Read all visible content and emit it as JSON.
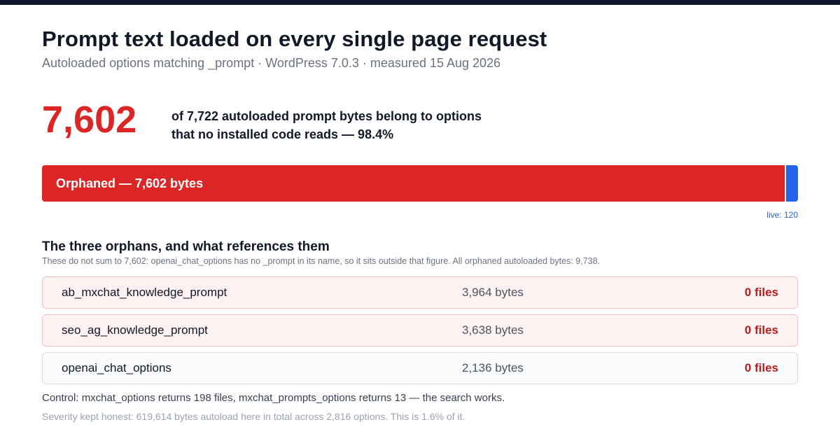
{
  "header": {
    "title": "Prompt text loaded on every single page request",
    "subtitle": "Autoloaded options matching _prompt · WordPress 7.0.3 · measured 15 Aug 2026"
  },
  "headline": {
    "value": "7,602",
    "description_line1": "of 7,722 autoloaded prompt bytes belong to options",
    "description_line2": "that no installed code reads — 98.4%"
  },
  "bar": {
    "orphaned_bytes": 7602,
    "live_bytes": 120,
    "orphaned_label": "Orphaned — 7,602 bytes",
    "live_label": "live: 120",
    "colors": {
      "orphaned": "#dc2626",
      "live": "#2563eb"
    }
  },
  "orphans": {
    "title": "The three orphans, and what references them",
    "note": "These do not sum to 7,602: openai_chat_options has no _prompt in its name, so it sits outside that figure. All orphaned autoloaded bytes: 9,738.",
    "rows": [
      {
        "name": "ab_mxchat_knowledge_prompt",
        "bytes": "3,964 bytes",
        "files": "0 files",
        "style": "orphan"
      },
      {
        "name": "seo_ag_knowledge_prompt",
        "bytes": "3,638 bytes",
        "files": "0 files",
        "style": "orphan"
      },
      {
        "name": "openai_chat_options",
        "bytes": "2,136 bytes",
        "files": "0 files",
        "style": "neutral"
      }
    ]
  },
  "footer": {
    "control": "Control: mxchat_options returns 198 files, mxchat_prompts_options returns 13 — the search works.",
    "severity": "Severity kept honest: 619,614 bytes autoload here in total across 2,816 options. This is 1.6% of it."
  }
}
